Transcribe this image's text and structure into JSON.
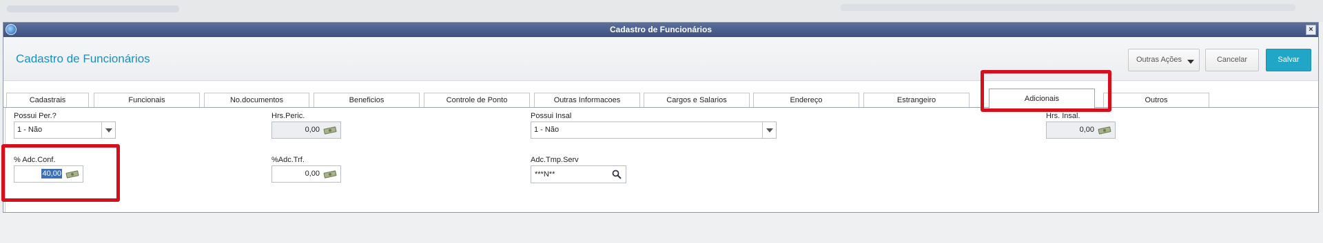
{
  "window": {
    "title": "Cadastro de Funcionários"
  },
  "header": {
    "page_title": "Cadastro de Funcionários",
    "buttons": {
      "outras_acoes": "Outras Ações",
      "cancelar": "Cancelar",
      "salvar": "Salvar"
    }
  },
  "tabs": [
    {
      "label": "Cadastrais"
    },
    {
      "label": "Funcionais"
    },
    {
      "label": "No.documentos"
    },
    {
      "label": "Beneficios"
    },
    {
      "label": "Controle de Ponto"
    },
    {
      "label": "Outras Informacoes"
    },
    {
      "label": "Cargos e Salarios"
    },
    {
      "label": "Endereço"
    },
    {
      "label": "Estrangeiro"
    },
    {
      "label": "Adicionais"
    },
    {
      "label": "Outros"
    }
  ],
  "active_tab": "Adicionais",
  "fields": {
    "possui_per": {
      "label": "Possui Per.?",
      "value": "1 - Não"
    },
    "hrs_peric": {
      "label": "Hrs.Peric.",
      "value": "0,00"
    },
    "possui_insal": {
      "label": "Possui Insal",
      "value": "1 - Não"
    },
    "hrs_insal": {
      "label": "Hrs. Insal.",
      "value": "0,00"
    },
    "adc_conf": {
      "label": "% Adc.Conf.",
      "value": "40,00"
    },
    "adc_trf": {
      "label": "%Adc.Trf.",
      "value": "0,00"
    },
    "adc_tmp_serv": {
      "label": "Adc.Tmp.Serv",
      "value": "***N**"
    }
  },
  "colors": {
    "accent": "#22a6c7",
    "title_blue": "#1c8ec4",
    "highlight": "#d4101d",
    "titlebar": "#4a5d8c"
  },
  "icons": {
    "app": "app-logo-icon",
    "close": "close-icon",
    "money": "money-bill-icon",
    "search": "search-icon",
    "dropdown": "chevron-down-icon"
  }
}
